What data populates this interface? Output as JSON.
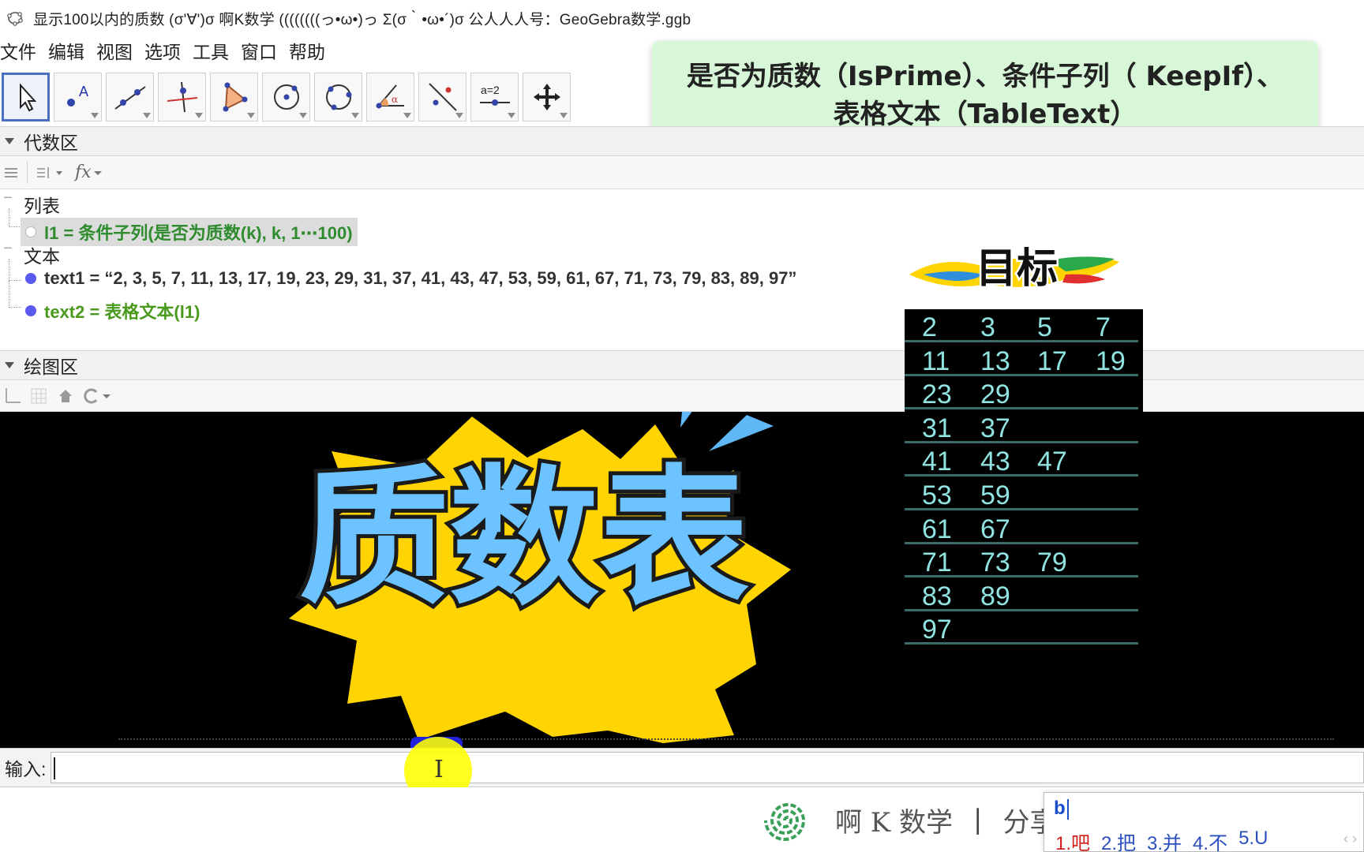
{
  "window": {
    "title": "显示100以内的质数    (σ'∀')σ  啊K数学    ((((((((っ•ω•)っ Σ(σ｀•ω•´)σ  公人人人号：GeoGebra数学.ggb"
  },
  "menubar": {
    "items": [
      "文件",
      "编辑",
      "视图",
      "选项",
      "工具",
      "窗口",
      "帮助"
    ]
  },
  "toolbar": {
    "tools": [
      {
        "name": "move-tool-icon",
        "selected": true
      },
      {
        "name": "point-tool-icon"
      },
      {
        "name": "line-tool-icon"
      },
      {
        "name": "perpendicular-line-tool-icon"
      },
      {
        "name": "polygon-tool-icon"
      },
      {
        "name": "circle-center-point-tool-icon"
      },
      {
        "name": "circle-three-points-tool-icon"
      },
      {
        "name": "angle-tool-icon"
      },
      {
        "name": "reflect-tool-icon"
      },
      {
        "name": "slider-tool-icon",
        "text": "a=2"
      },
      {
        "name": "move-graphics-tool-icon"
      }
    ]
  },
  "callout": {
    "line1": "是否为质数（IsPrime）、条件子列（ KeepIf）、",
    "line2": "表格文本（TableText）"
  },
  "algebra_view": {
    "header": "代数区",
    "subbar": {
      "fx_label": "fx"
    },
    "groups": {
      "list_label": "列表",
      "text_label": "文本"
    },
    "rows": {
      "l1": "l1 = 条件子列(是否为质数(k), k, 1⋯100)",
      "text1": "text1 = “2, 3, 5, 7, 11, 13, 17, 19, 23, 29, 31, 37, 41, 43, 47, 53, 59, 61, 67, 71, 73, 79, 83, 89, 97”",
      "text2": "text2 = 表格文本(l1)"
    }
  },
  "graphics_view": {
    "header": "绘图区",
    "headline": "质数表",
    "goal_label": "目标",
    "prime_table": [
      [
        "2",
        "3",
        "5",
        "7"
      ],
      [
        "11",
        "13",
        "17",
        "19"
      ],
      [
        "23",
        "29"
      ],
      [
        "31",
        "37"
      ],
      [
        "41",
        "43",
        "47"
      ],
      [
        "53",
        "59"
      ],
      [
        "61",
        "67"
      ],
      [
        "71",
        "73",
        "79"
      ],
      [
        "83",
        "89"
      ],
      [
        "97"
      ]
    ]
  },
  "input_bar": {
    "label": "输入:",
    "value": ""
  },
  "watermark": {
    "brand": "啊 K 数学",
    "sep": "|",
    "tail": "分享"
  },
  "ime": {
    "input": "b",
    "candidates": [
      "1.吧",
      "2.把",
      "3.并",
      "4.不",
      "5.U"
    ]
  },
  "colors": {
    "callout_bg": "#d8f7d8",
    "burst_yellow": "#ffd400",
    "headline_blue": "#6cc3ff",
    "table_text": "#8fe3e0",
    "table_rule": "#3a6b68",
    "algebra_l1": "#2e8b2e",
    "algebra_text2": "#4a9a1e",
    "object_dot": "#5a5aee"
  }
}
